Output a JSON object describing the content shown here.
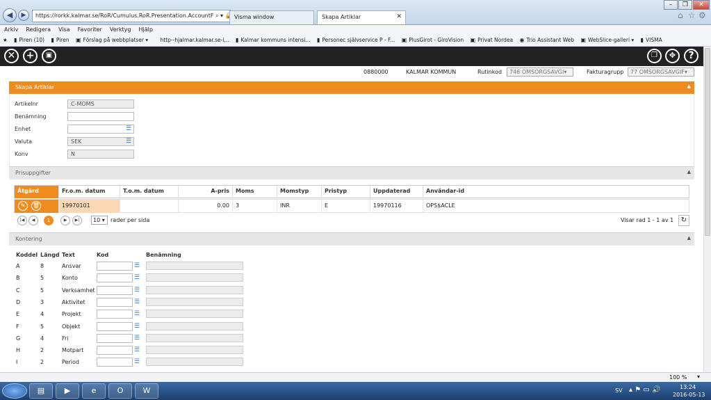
{
  "browser": {
    "address": "https://rorkk.kalmar.se/RoR/Cumulus.RoR.Presentation.AccountF",
    "tabs": [
      {
        "label": "Visma window"
      },
      {
        "label": "Skapa Artiklar"
      }
    ],
    "menu": [
      "Arkiv",
      "Redigera",
      "Visa",
      "Favoriter",
      "Verktyg",
      "Hjälp"
    ],
    "favorites": [
      "Piren (10)",
      "Piren",
      "Förslag på webbplatser ▾",
      "http--hjalmar.kalmar.se-i...",
      "Kalmar kommuns intensi...",
      "Personec självservice P - F...",
      "PlusGirot - GiroVision",
      "Privat  Nordea",
      "Trio Assistant Web",
      "WebSlice-galleri ▾",
      "VISMA"
    ],
    "zoom": "100 %"
  },
  "header": {
    "org_number": "0880000",
    "org_name": "KALMAR KOMMUN",
    "rutinkod_label": "Rutinkod",
    "rutinkod_value": "746 OMSORGSAVGI▾",
    "fakturagrupp_label": "Fakturagrupp",
    "fakturagrupp_value": "77 OMSORGSAVGIF▾"
  },
  "skapa": {
    "title": "Skapa Artiklar",
    "fields": {
      "artikelnr_label": "Artikelnr",
      "artikelnr_value": "C-MOMS",
      "benamning_label": "Benämning",
      "benamning_value": "",
      "enhet_label": "Enhet",
      "enhet_value": "",
      "valuta_label": "Valuta",
      "valuta_value": "SEK",
      "konv_label": "Konv",
      "konv_value": "N"
    }
  },
  "pris": {
    "title": "Prisuppgifter",
    "columns": [
      "Åtgärd",
      "Fr.o.m. datum",
      "T.o.m. datum",
      "A-pris",
      "Moms",
      "Momstyp",
      "Pristyp",
      "Uppdaterad",
      "Användar-id"
    ],
    "row": {
      "from": "19970101",
      "tom": "",
      "apris": "0.00",
      "moms": "3",
      "momstyp": "INR",
      "pristyp": "E",
      "uppdaterad": "19970116",
      "anvandar": "OPS$ACLE"
    },
    "page": "1",
    "per_page": "10",
    "per_page_label": "rader per sida",
    "range": "Visar rad 1 - 1 av 1"
  },
  "kontering": {
    "title": "Kontering",
    "columns": [
      "Koddel",
      "Längd",
      "Text",
      "Kod",
      "Benämning"
    ],
    "rows": [
      {
        "koddel": "A",
        "langd": "8",
        "text": "Ansvar"
      },
      {
        "koddel": "B",
        "langd": "5",
        "text": "Konto"
      },
      {
        "koddel": "C",
        "langd": "5",
        "text": "Verksamhet"
      },
      {
        "koddel": "D",
        "langd": "3",
        "text": "Aktivitet"
      },
      {
        "koddel": "E",
        "langd": "4",
        "text": "Projekt"
      },
      {
        "koddel": "F",
        "langd": "5",
        "text": "Objekt"
      },
      {
        "koddel": "G",
        "langd": "4",
        "text": "Fri"
      },
      {
        "koddel": "H",
        "langd": "2",
        "text": "Motpart"
      },
      {
        "koddel": "I",
        "langd": "2",
        "text": "Period"
      }
    ]
  },
  "taskbar": {
    "lang": "SV",
    "time": "13:24",
    "date": "2016-05-13"
  },
  "colors": {
    "accent": "#f08c1e",
    "toolbar": "#222222"
  }
}
